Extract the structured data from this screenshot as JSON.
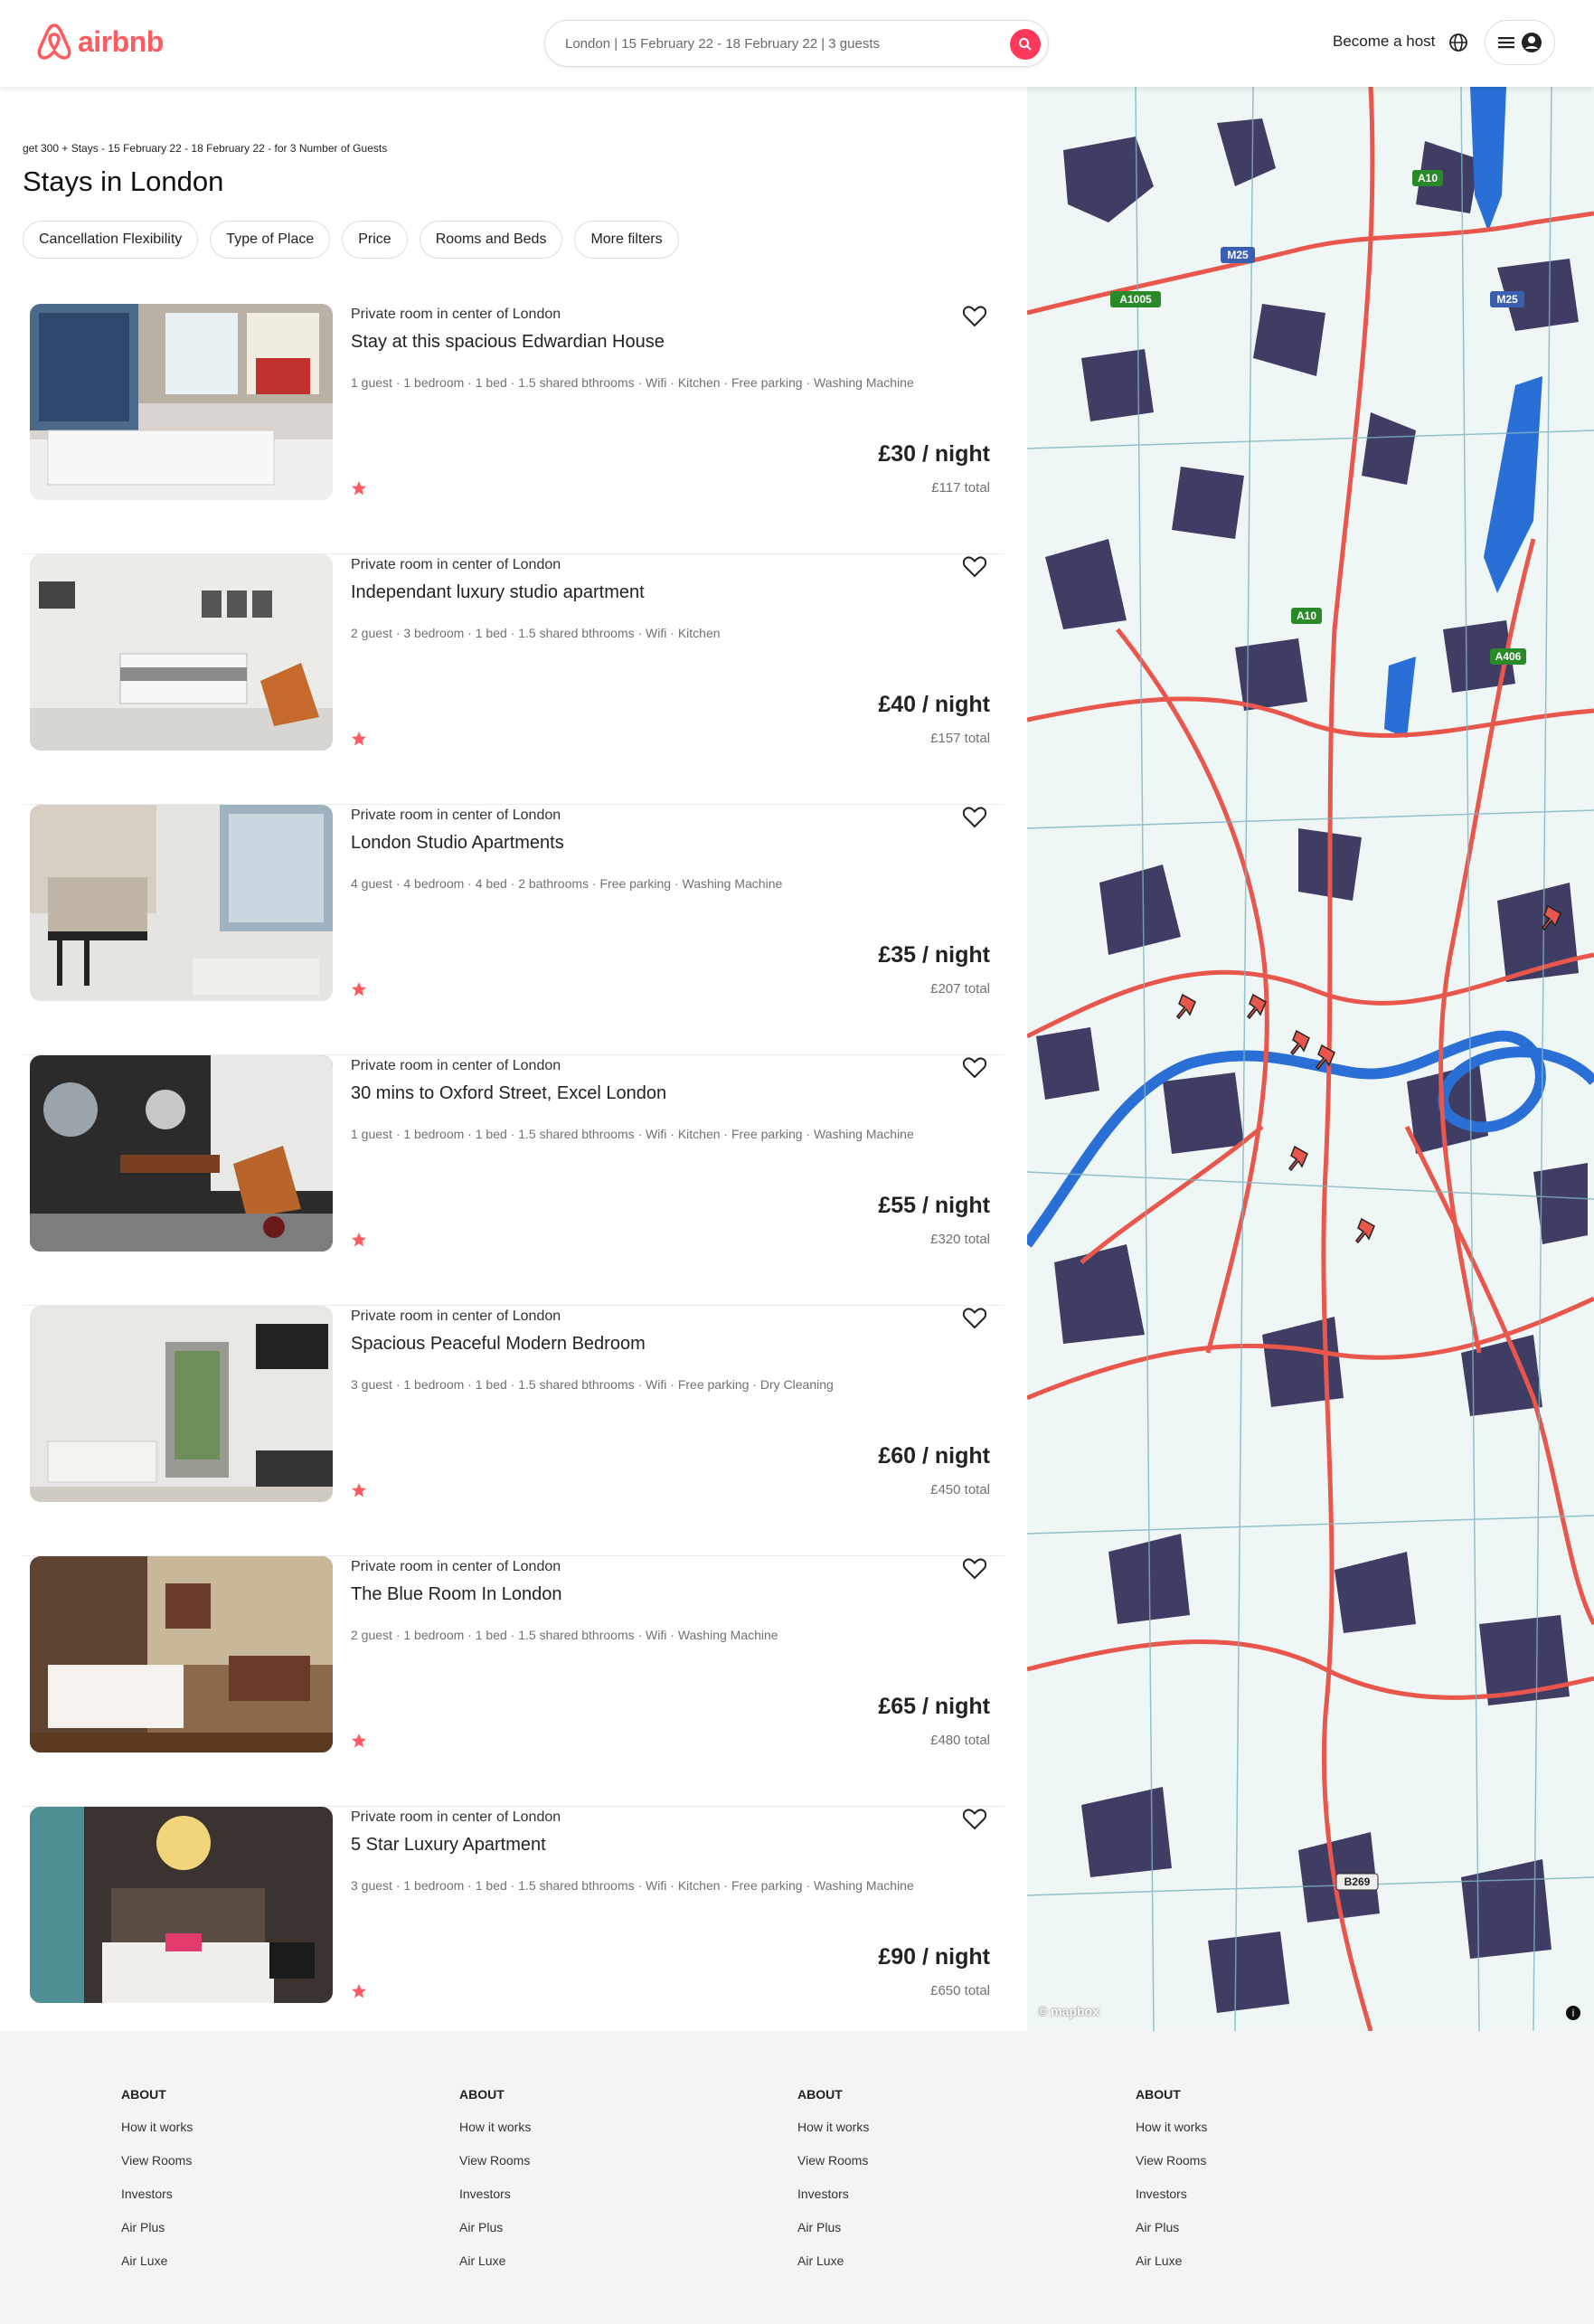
{
  "header": {
    "brand": "airbnb",
    "search_text": "London | 15 February 22 - 18 February 22 | 3 guests",
    "become_host": "Become a host"
  },
  "main": {
    "subtitle": "get 300 + Stays - 15 February 22 - 18 February 22 - for 3 Number of Guests",
    "title": "Stays in London",
    "filters": [
      "Cancellation Flexibility",
      "Type of Place",
      "Price",
      "Rooms and Beds",
      "More filters"
    ]
  },
  "listings": [
    {
      "type": "Private room in center of London",
      "title": "Stay at this spacious Edwardian House",
      "amenities": "1 guest · 1 bedroom · 1 bed · 1.5 shared bthrooms · Wifi · Kitchen · Free parking · Washing Machine",
      "price": "£30 / night",
      "total": "£117 total"
    },
    {
      "type": "Private room in center of London",
      "title": "Independant luxury studio apartment",
      "amenities": "2 guest · 3 bedroom · 1 bed · 1.5 shared bthrooms · Wifi · Kitchen",
      "price": "£40 / night",
      "total": "£157 total"
    },
    {
      "type": "Private room in center of London",
      "title": "London Studio Apartments",
      "amenities": "4 guest · 4 bedroom · 4 bed · 2 bathrooms · Free parking · Washing Machine",
      "price": "£35 / night",
      "total": "£207 total"
    },
    {
      "type": "Private room in center of London",
      "title": "30 mins to Oxford Street, Excel London",
      "amenities": "1 guest · 1 bedroom · 1 bed · 1.5 shared bthrooms · Wifi · Kitchen · Free parking · Washing Machine",
      "price": "£55 / night",
      "total": "£320 total"
    },
    {
      "type": "Private room in center of London",
      "title": "Spacious Peaceful Modern Bedroom",
      "amenities": "3 guest · 1 bedroom · 1 bed · 1.5 shared bthrooms · Wifi · Free parking · Dry Cleaning",
      "price": "£60 / night",
      "total": "£450 total"
    },
    {
      "type": "Private room in center of London",
      "title": "The Blue Room In London",
      "amenities": "2 guest · 1 bedroom · 1 bed · 1.5 shared bthrooms · Wifi · Washing Machine",
      "price": "£65 / night",
      "total": "£480 total"
    },
    {
      "type": "Private room in center of London",
      "title": "5 Star Luxury Apartment",
      "amenities": "3 guest · 1 bedroom · 1 bed · 1.5 shared bthrooms · Wifi · Kitchen · Free parking · Washing Machine",
      "price": "£90 / night",
      "total": "£650 total"
    }
  ],
  "map": {
    "road_labels": [
      "A10",
      "M25",
      "A1005",
      "M25",
      "A10",
      "A406",
      "B269"
    ],
    "attribution": "© mapbox"
  },
  "footer": {
    "columns": [
      {
        "heading": "ABOUT",
        "links": [
          "How it works",
          "View Rooms",
          "Investors",
          "Air Plus",
          "Air Luxe"
        ]
      },
      {
        "heading": "ABOUT",
        "links": [
          "How it works",
          "View Rooms",
          "Investors",
          "Air Plus",
          "Air Luxe"
        ]
      },
      {
        "heading": "ABOUT",
        "links": [
          "How it works",
          "View Rooms",
          "Investors",
          "Air Plus",
          "Air Luxe"
        ]
      },
      {
        "heading": "ABOUT",
        "links": [
          "How it works",
          "View Rooms",
          "Investors",
          "Air Plus",
          "Air Luxe"
        ]
      }
    ]
  },
  "colors": {
    "brand": "#ff5a5f",
    "search_button": "#ff385c",
    "map_road": "#e8564c",
    "map_water": "#2a6fd6",
    "map_block": "#3f3d63"
  }
}
